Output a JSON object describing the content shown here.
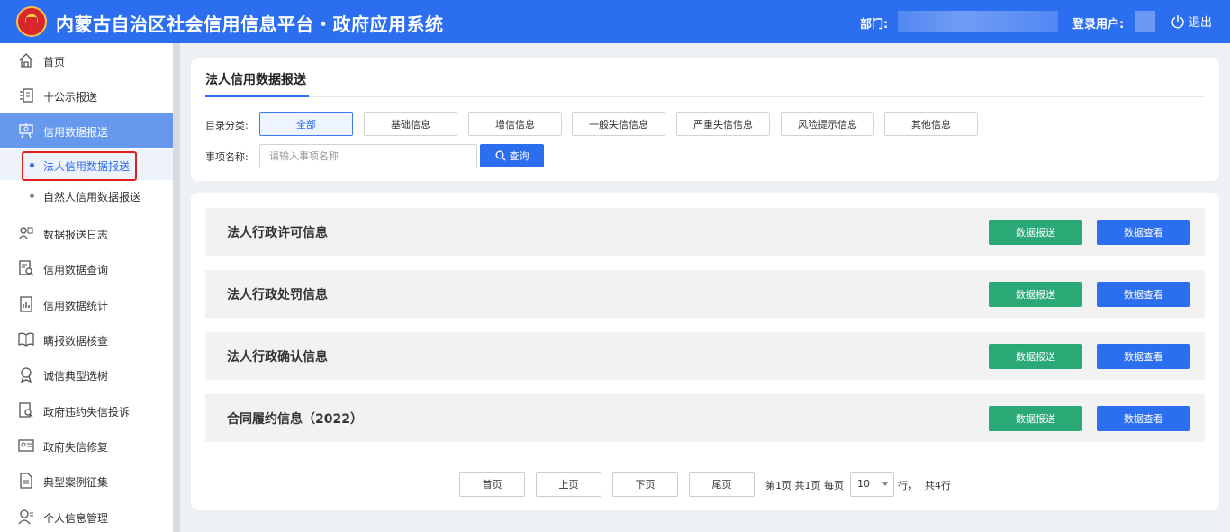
{
  "header": {
    "title": "内蒙古自治区社会信用信息平台・政府应用系统",
    "dept_label": "部门:",
    "user_label": "登录用户:",
    "logout_label": "退出"
  },
  "sidebar": {
    "items": [
      {
        "label": "首页",
        "icon": "home-icon"
      },
      {
        "label": "十公示报送",
        "icon": "list-icon"
      },
      {
        "label": "信用数据报送",
        "icon": "presentation-icon"
      },
      {
        "label": "数据报送日志",
        "icon": "log-icon"
      },
      {
        "label": "信用数据查询",
        "icon": "search-doc-icon"
      },
      {
        "label": "信用数据统计",
        "icon": "stats-icon"
      },
      {
        "label": "瞒报数据核查",
        "icon": "book-icon"
      },
      {
        "label": "诚信典型选树",
        "icon": "award-icon"
      },
      {
        "label": "政府违约失信投诉",
        "icon": "complaint-icon"
      },
      {
        "label": "政府失信修复",
        "icon": "repair-icon"
      },
      {
        "label": "典型案例征集",
        "icon": "case-icon"
      },
      {
        "label": "个人信息管理",
        "icon": "user-icon"
      }
    ],
    "sub_items": [
      {
        "label": "法人信用数据报送"
      },
      {
        "label": "自然人信用数据报送"
      }
    ]
  },
  "filter": {
    "page_tab": "法人信用数据报送",
    "category_label": "目录分类:",
    "categories": [
      "全部",
      "基础信息",
      "增信信息",
      "一般失信信息",
      "严重失信信息",
      "风险提示信息",
      "其他信息"
    ],
    "name_label": "事项名称:",
    "search_placeholder": "请输入事项名称",
    "query_label": "查询"
  },
  "rows": [
    {
      "title": "法人行政许可信息",
      "report_label": "数据报送",
      "view_label": "数据查看"
    },
    {
      "title": "法人行政处罚信息",
      "report_label": "数据报送",
      "view_label": "数据查看"
    },
    {
      "title": "法人行政确认信息",
      "report_label": "数据报送",
      "view_label": "数据查看"
    },
    {
      "title": "合同履约信息（2022）",
      "report_label": "数据报送",
      "view_label": "数据查看"
    }
  ],
  "pagination": {
    "first": "首页",
    "prev": "上页",
    "next": "下页",
    "last": "尾页",
    "page_info": "第1页  共1页  每页",
    "page_size": "10",
    "rows_unit": "行，",
    "total": "共4行"
  },
  "colors": {
    "primary": "#2c6ef0",
    "success": "#2aa876",
    "highlight": "#e21d1d"
  }
}
